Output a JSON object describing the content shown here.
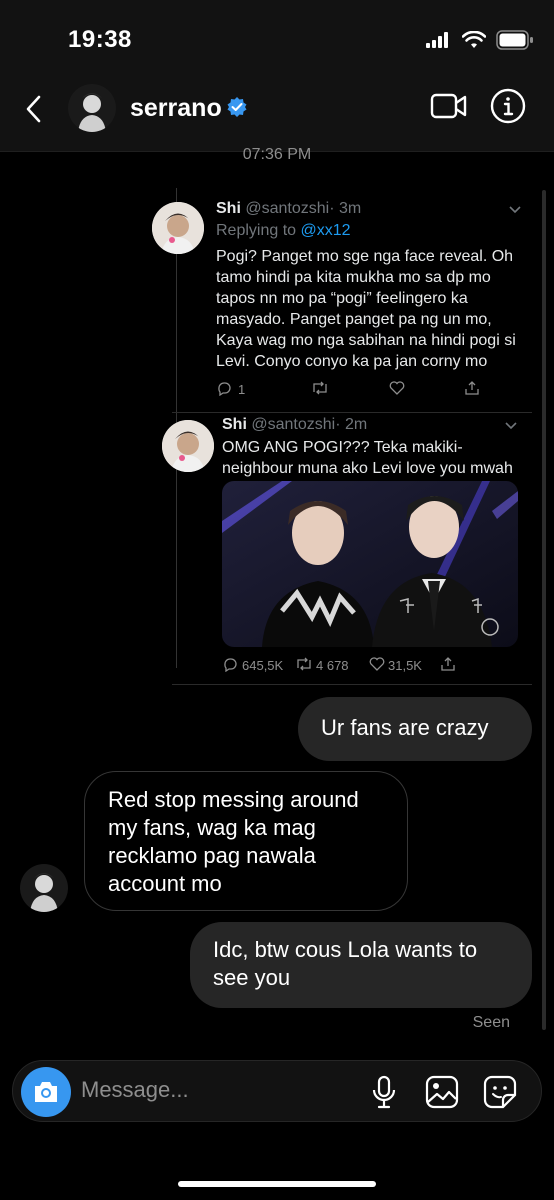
{
  "status_bar": {
    "time": "19:38"
  },
  "header": {
    "username": "serrano",
    "verified": true
  },
  "conversation": {
    "timestamp": "07:36 PM",
    "shared_tweet": {
      "main": {
        "name": "Shi",
        "handle": "@santozshi",
        "age": "· 3m",
        "replying_prefix": "Replying to",
        "replying_to": "@xx12",
        "lines": [
          "Pogi? Panget mo sge nga face reveal. Oh",
          "tamo hindi pa kita mukha mo sa dp mo",
          "tapos nn mo pa “pogi” feelingero ka",
          "masyado. Panget panget pa ng un mo,",
          "Kaya wag mo nga sabihan na hindi pogi si",
          "Levi. Conyo conyo ka pa jan corny mo"
        ],
        "reply_count": "1"
      },
      "quoted": {
        "name": "Shi",
        "handle": "@santozshi",
        "age": "· 2m",
        "lines": [
          "OMG ANG POGI??? Teka makiki-",
          "neighbour muna ako Levi love you mwah"
        ],
        "reply_count": "645,5K",
        "retweet_count": "4 678",
        "like_count": "31,5K"
      }
    },
    "messages": [
      {
        "id": "m1",
        "direction": "out",
        "lines": [
          "Ur fans are crazy"
        ]
      },
      {
        "id": "m2",
        "direction": "in",
        "lines": [
          "Red stop messing around",
          "my fans, wag ka mag",
          "recklamo pag nawala",
          "account mo"
        ]
      },
      {
        "id": "m3",
        "direction": "out",
        "lines": [
          "Idc, btw cous Lola wants to",
          "see you"
        ]
      }
    ],
    "seen_label": "Seen"
  },
  "composer": {
    "placeholder": "Message..."
  },
  "colors": {
    "accent": "#3797f0",
    "bubble_out": "#262626",
    "twitter_blue": "#1d9bf0",
    "verified": "#3897f0"
  },
  "icons": [
    "back-arrow-icon",
    "verified-badge-icon",
    "video-call-icon",
    "info-icon",
    "camera-icon",
    "microphone-icon",
    "gallery-icon",
    "sticker-icon",
    "signal-icon",
    "wifi-icon",
    "battery-icon"
  ]
}
